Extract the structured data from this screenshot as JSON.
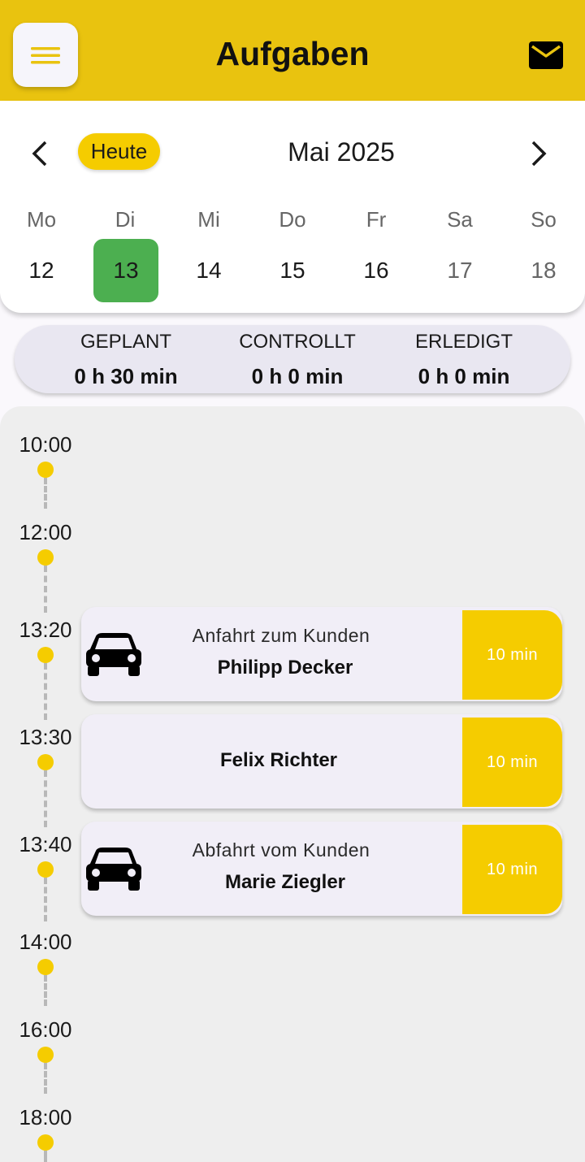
{
  "header": {
    "title": "Aufgaben",
    "menu_icon": "hamburger-menu-icon",
    "mail_icon": "envelope-icon",
    "bar_color": "#e9c30f"
  },
  "calendar": {
    "today_label": "Heute",
    "month_label": "Mai 2025",
    "weekdays": [
      "Mo",
      "Di",
      "Mi",
      "Do",
      "Fr",
      "Sa",
      "So"
    ],
    "days": [
      "12",
      "13",
      "14",
      "15",
      "16",
      "17",
      "18"
    ],
    "selected_day": "13",
    "selected_color": "#4caf50"
  },
  "summary": {
    "planned_label": "GEPLANT",
    "planned_value": "0 h 30 min",
    "controlled_label": "CONTROLLT",
    "controlled_value": "0 h 0 min",
    "done_label": "ERLEDIGT",
    "done_value": "0 h 0 min"
  },
  "timeline": {
    "times": [
      "10:00",
      "12:00",
      "13:20",
      "13:30",
      "13:40",
      "14:00",
      "16:00",
      "18:00"
    ],
    "accent_color": "#f5cc00",
    "tasks": [
      {
        "type": "Anfahrt zum Kunden",
        "name": "Philipp Decker",
        "duration": "10 min",
        "icon": "car-icon"
      },
      {
        "type": "",
        "name": "Felix Richter",
        "duration": "10 min",
        "icon": ""
      },
      {
        "type": "Abfahrt vom Kunden",
        "name": "Marie Ziegler",
        "duration": "10 min",
        "icon": "car-icon"
      }
    ]
  }
}
